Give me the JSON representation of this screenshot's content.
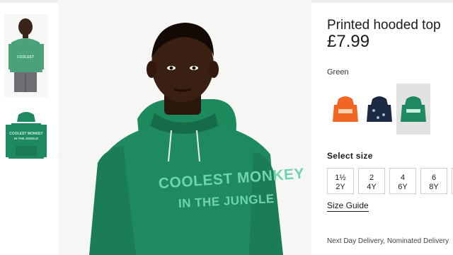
{
  "product": {
    "title": "Printed hooded top",
    "price": "£7.99",
    "selected_color": "Green",
    "print_text": [
      "COOLEST MONKEY",
      "IN THE JUNGLE"
    ]
  },
  "swatches": [
    {
      "name": "orange",
      "color": "#f26522",
      "selected": false
    },
    {
      "name": "navy",
      "color": "#1c2a44",
      "selected": false
    },
    {
      "name": "green",
      "color": "#1f8a5f",
      "selected": true
    }
  ],
  "sizes": {
    "label": "Select size",
    "options": [
      {
        "top": "1½",
        "bottom": "2Y"
      },
      {
        "top": "2",
        "bottom": "4Y"
      },
      {
        "top": "4",
        "bottom": "6Y"
      },
      {
        "top": "6",
        "bottom": "8Y"
      }
    ]
  },
  "size_guide": "Size Guide",
  "delivery": "Next Day Delivery, Nominated Delivery",
  "colors": {
    "hoodie_green": "#1f8a5f",
    "print_mint": "#6fd3ae",
    "text": "#1b1b1b"
  }
}
